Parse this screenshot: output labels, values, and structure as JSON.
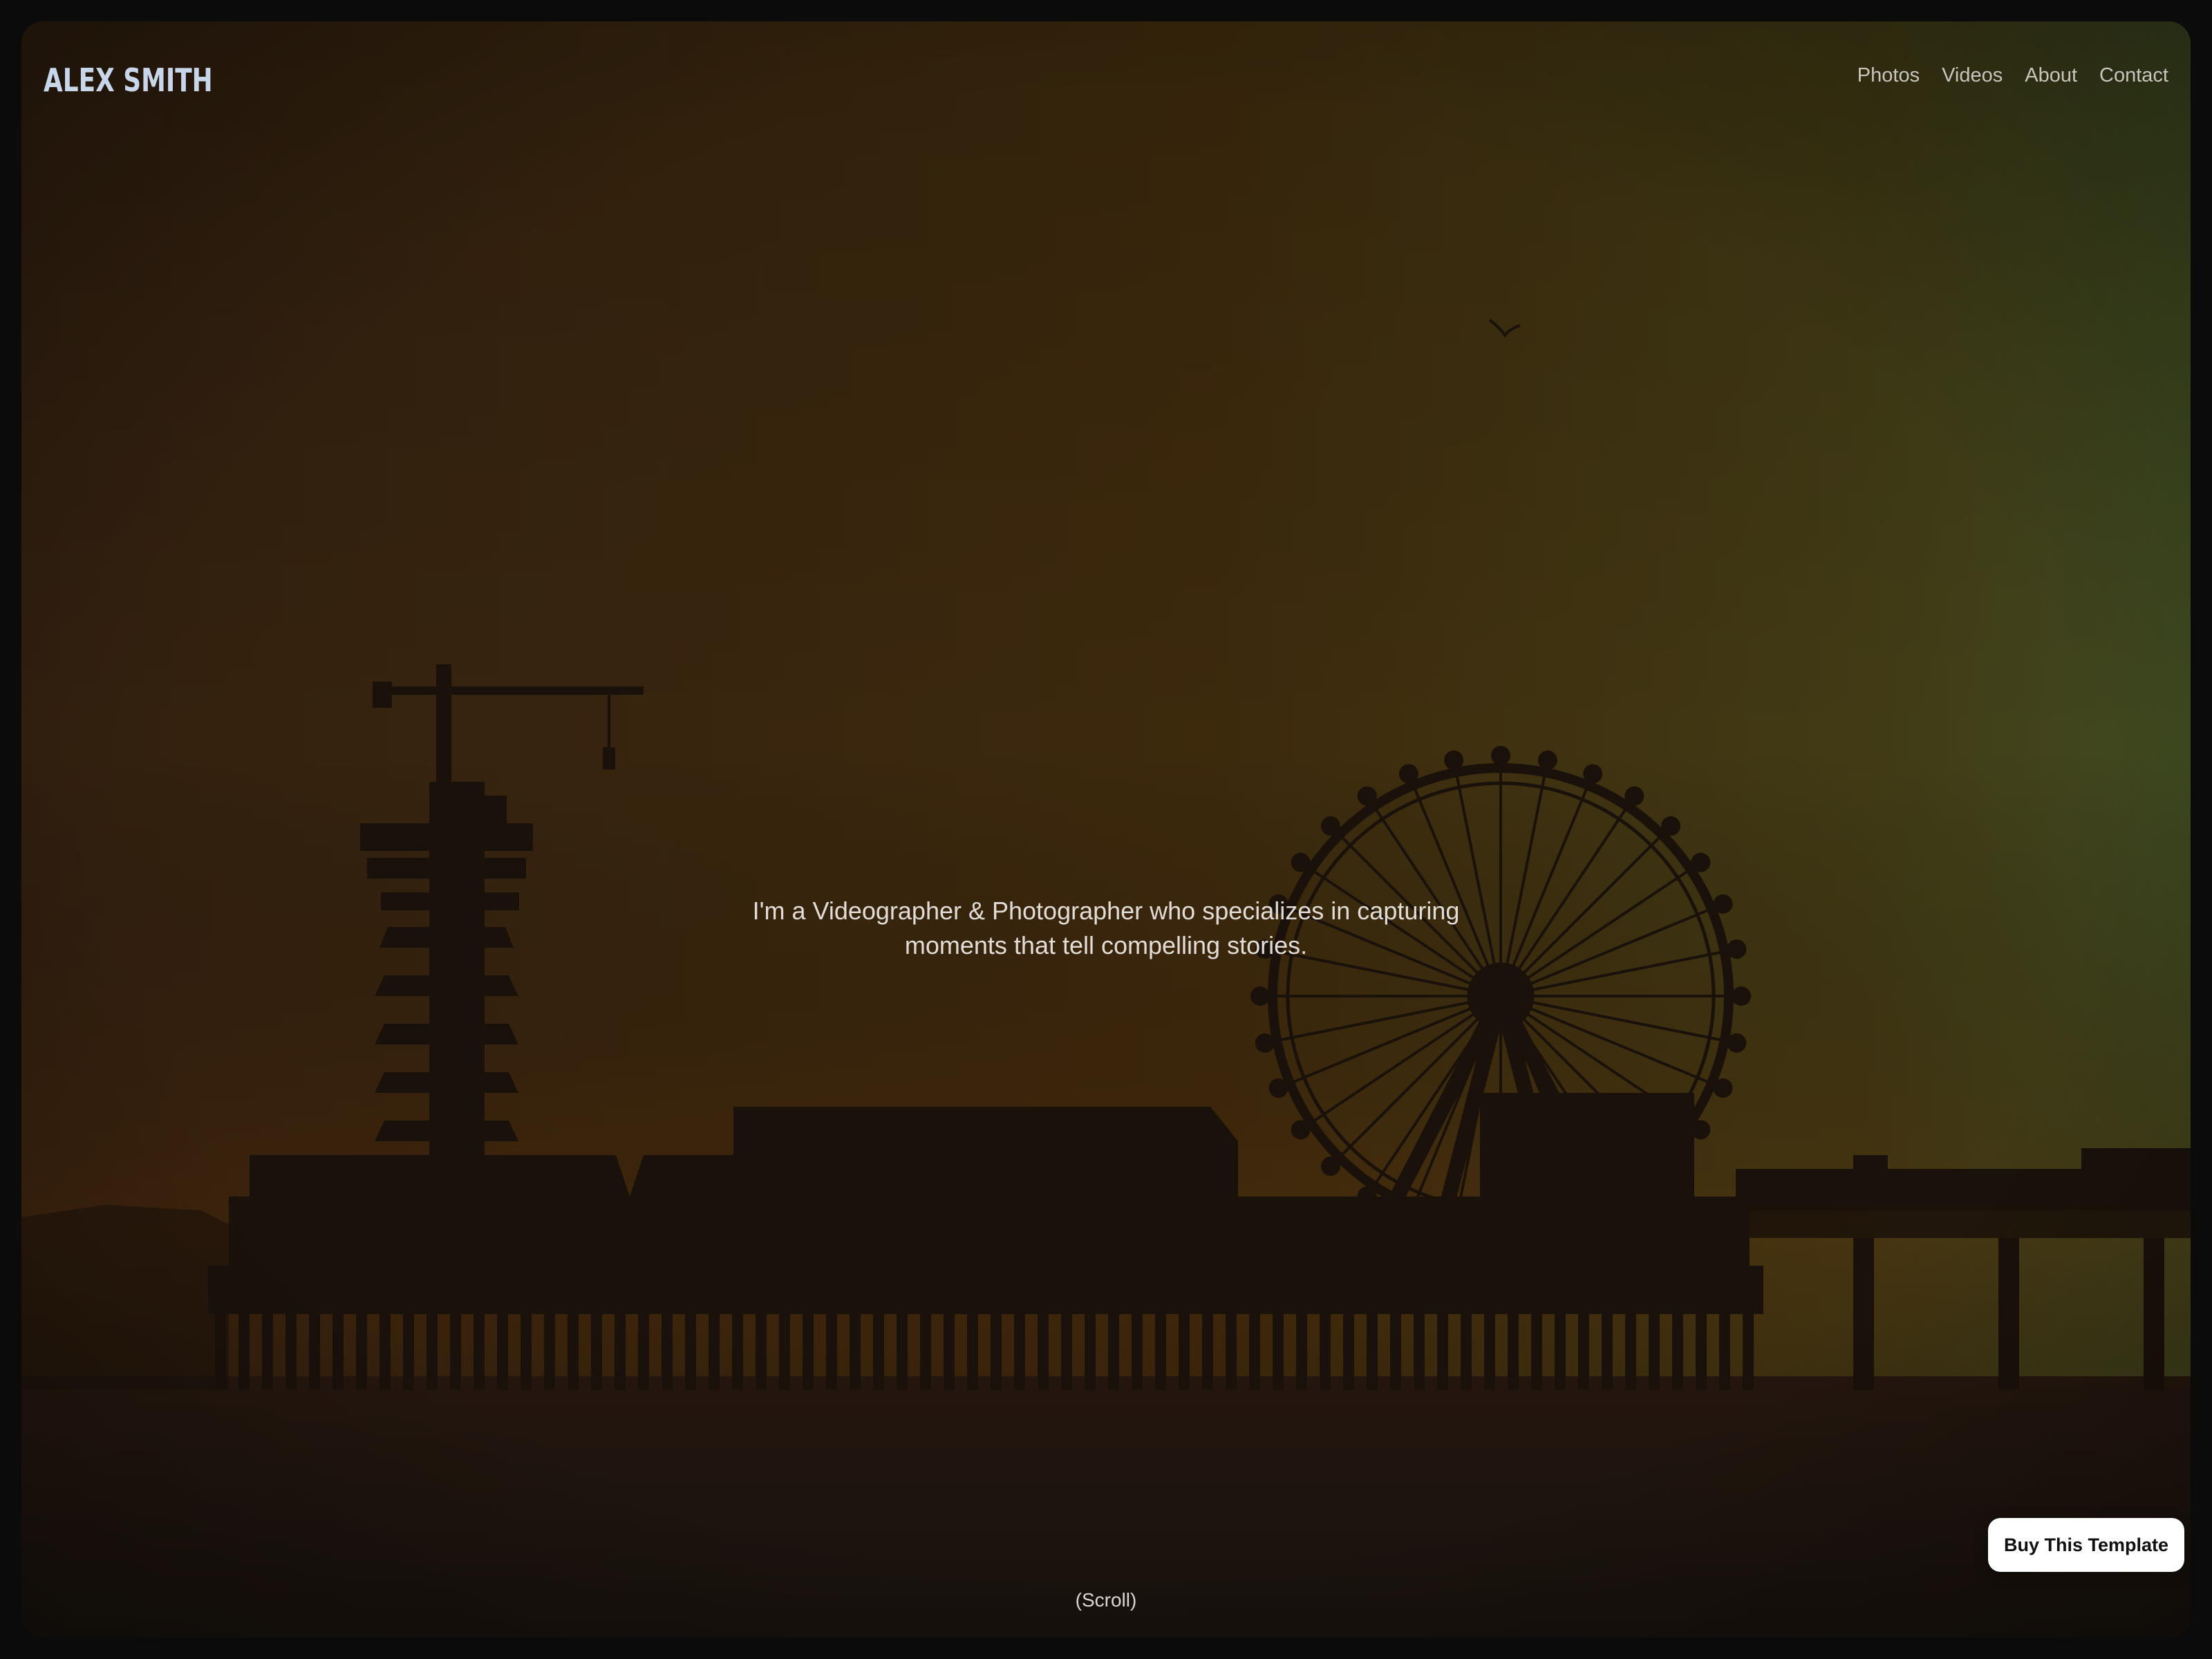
{
  "brand": {
    "name": "ALEX SMITH"
  },
  "nav": {
    "items": [
      {
        "label": "Photos"
      },
      {
        "label": "Videos"
      },
      {
        "label": "About"
      },
      {
        "label": "Contact"
      }
    ]
  },
  "hero": {
    "tagline_line1": "I'm a Videographer & Photographer who specializes in capturing",
    "tagline_line2": "moments that tell compelling stories.",
    "scroll_hint": "(Scroll)",
    "image_subject": "pier-ferris-wheel-sunset-silhouette"
  },
  "cta": {
    "buy_label": "Buy This Template"
  },
  "colors": {
    "page_background": "#0b0b0b",
    "sky_warm": "#4a2e12",
    "sky_green": "#465425",
    "silhouette": "#1e140c",
    "logo": "#c8d6ea",
    "button_bg": "#ffffff"
  }
}
